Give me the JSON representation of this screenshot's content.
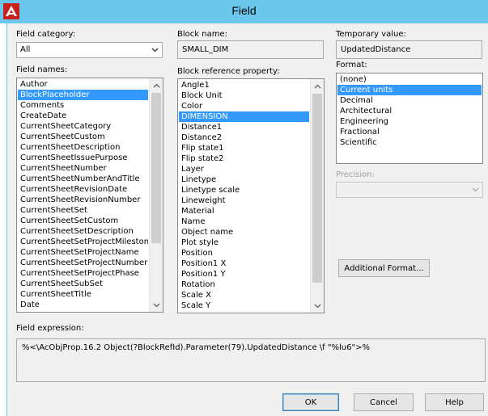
{
  "window": {
    "title": "Field"
  },
  "field_category": {
    "label": "Field category:",
    "value": "All"
  },
  "field_names": {
    "label": "Field names:",
    "items": [
      "Author",
      "BlockPlaceholder",
      "Comments",
      "CreateDate",
      "CurrentSheetCategory",
      "CurrentSheetCustom",
      "CurrentSheetDescription",
      "CurrentSheetIssuePurpose",
      "CurrentSheetNumber",
      "CurrentSheetNumberAndTitle",
      "CurrentSheetRevisionDate",
      "CurrentSheetRevisionNumber",
      "CurrentSheetSet",
      "CurrentSheetSetCustom",
      "CurrentSheetSetDescription",
      "CurrentSheetSetProjectMilestone",
      "CurrentSheetSetProjectName",
      "CurrentSheetSetProjectNumber",
      "CurrentSheetSetProjectPhase",
      "CurrentSheetSubSet",
      "CurrentSheetTitle",
      "Date"
    ],
    "selected": "BlockPlaceholder"
  },
  "block_name": {
    "label": "Block name:",
    "value": "SMALL_DIM"
  },
  "block_reference_property": {
    "label": "Block reference property:",
    "items": [
      "Angle1",
      "Block Unit",
      "Color",
      "DIMENSION",
      "Distance1",
      "Distance2",
      "Flip state1",
      "Flip state2",
      "Layer",
      "Linetype",
      "Linetype scale",
      "Lineweight",
      "Material",
      "Name",
      "Object name",
      "Plot style",
      "Position",
      "Position1 X",
      "Position1 Y",
      "Rotation",
      "Scale X",
      "Scale Y"
    ],
    "selected": "DIMENSION"
  },
  "temporary_value": {
    "label": "Temporary value:",
    "value": "UpdatedDistance"
  },
  "format": {
    "label": "Format:",
    "items": [
      "(none)",
      "Current units",
      "Decimal",
      "Architectural",
      "Engineering",
      "Fractional",
      "Scientific"
    ],
    "selected": "Current units"
  },
  "precision": {
    "label": "Precision:",
    "value": ""
  },
  "additional_format_label": "Additional Format...",
  "field_expression": {
    "label": "Field expression:",
    "value": "%<\\AcObjProp.16.2 Object(?BlockRefId).Parameter(79).UpdatedDistance \\f \"%lu6\">%"
  },
  "buttons": {
    "ok": "OK",
    "cancel": "Cancel",
    "help": "Help"
  },
  "colors": {
    "titlebar": "#6cc7ec",
    "selection": "#3399ff",
    "dialog_bg": "#f0f0f0"
  }
}
